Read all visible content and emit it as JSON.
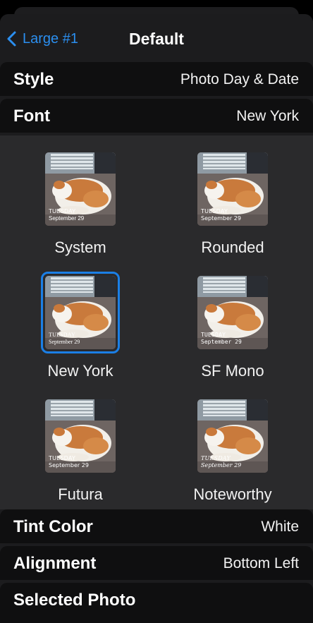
{
  "nav": {
    "back_label": "Large #1",
    "title": "Default"
  },
  "rows": {
    "style": {
      "label": "Style",
      "value": "Photo Day & Date"
    },
    "font": {
      "label": "Font",
      "value": "New York"
    },
    "tint": {
      "label": "Tint Color",
      "value": "White"
    },
    "alignment": {
      "label": "Alignment",
      "value": "Bottom Left"
    },
    "photo": {
      "label": "Selected Photo"
    }
  },
  "fonts": [
    {
      "name": "System",
      "day": "TUESDAY",
      "date": "September 29"
    },
    {
      "name": "Rounded",
      "day": "TUESDAY",
      "date": "September 29"
    },
    {
      "name": "New York",
      "day": "TUESDAY",
      "date": "September 29",
      "selected": true
    },
    {
      "name": "SF Mono",
      "day": "TUESDAY",
      "date": "September 29"
    },
    {
      "name": "Futura",
      "day": "TUESDAY",
      "date": "September 29"
    },
    {
      "name": "Noteworthy",
      "day": "TUESDAY",
      "date": "September 29"
    }
  ],
  "colors": {
    "accent": "#2b8ff0",
    "selection_border": "#1b7fe6",
    "row_background": "#0f0f10",
    "grid_background": "#2a2a2c"
  }
}
